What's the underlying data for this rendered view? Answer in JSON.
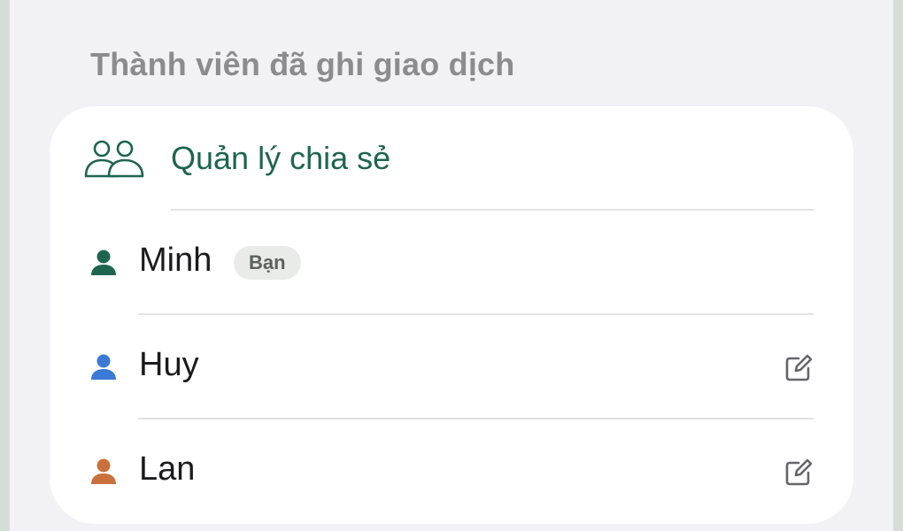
{
  "section": {
    "title": "Thành viên đã ghi giao dịch"
  },
  "manage": {
    "label": "Quản lý chia sẻ",
    "icon": "people-icon",
    "color": "#1e6550"
  },
  "members": [
    {
      "name": "Minh",
      "badge": "Bạn",
      "icon": "person-icon",
      "color": "#1e6550",
      "editable": false
    },
    {
      "name": "Huy",
      "icon": "person-icon",
      "color": "#3a7ad6",
      "editable": true
    },
    {
      "name": "Lan",
      "icon": "person-icon",
      "color": "#c9703b",
      "editable": true
    }
  ],
  "icons": {
    "edit": "edit-icon"
  }
}
